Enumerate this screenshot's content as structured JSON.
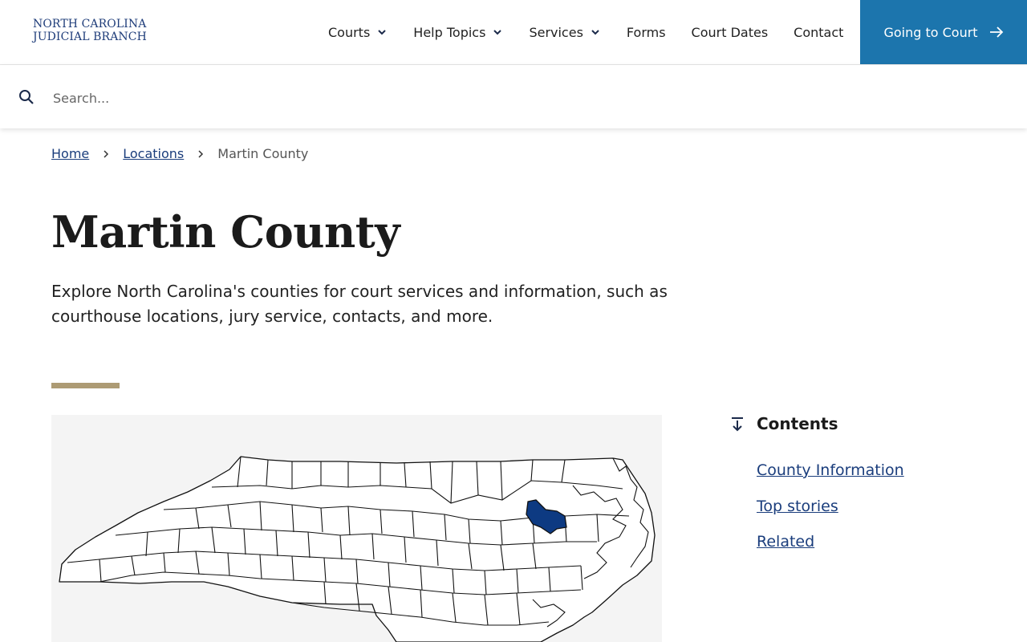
{
  "header": {
    "logo_line1": "NORTH CAROLINA",
    "logo_line2": "JUDICIAL BRANCH",
    "nav": [
      {
        "label": "Courts",
        "dropdown": true
      },
      {
        "label": "Help Topics",
        "dropdown": true
      },
      {
        "label": "Services",
        "dropdown": true
      },
      {
        "label": "Forms",
        "dropdown": false
      },
      {
        "label": "Court Dates",
        "dropdown": false
      },
      {
        "label": "Contact",
        "dropdown": false
      }
    ],
    "cta_label": "Going to Court"
  },
  "search": {
    "placeholder": "Search..."
  },
  "breadcrumb": {
    "home": "Home",
    "locations": "Locations",
    "current": "Martin County"
  },
  "page": {
    "title": "Martin County",
    "lead": "Explore North Carolina's counties for court services and information, such as courthouse locations, jury service, contacts, and more."
  },
  "contents": {
    "heading": "Contents",
    "items": [
      "County Information",
      "Top stories",
      "Related"
    ]
  },
  "colors": {
    "brand_blue": "#1c75ad",
    "link_navy": "#1a3d7c",
    "accent_gold": "#ad9b74",
    "county_highlight": "#0d3a82"
  }
}
